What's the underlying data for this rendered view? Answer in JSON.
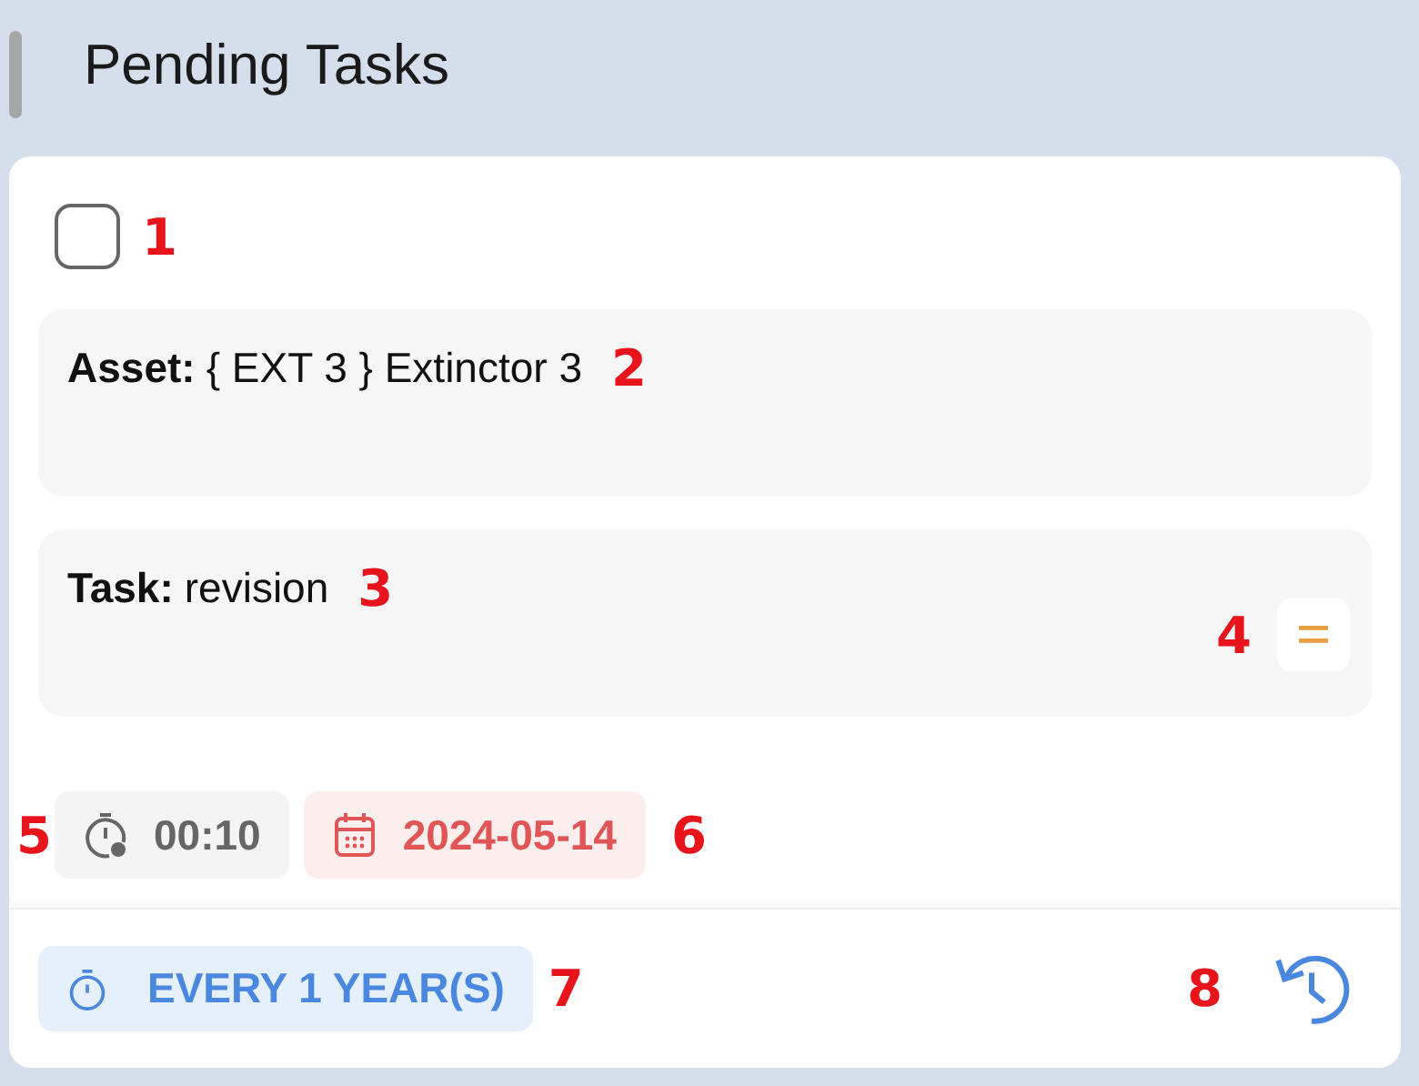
{
  "header": {
    "title": "Pending Tasks"
  },
  "task_card": {
    "checkbox": {
      "checked": false
    },
    "asset": {
      "label": "Asset:",
      "value": "{ EXT 3 } Extinctor 3"
    },
    "task": {
      "label": "Task:",
      "value": "revision"
    },
    "duration": "00:10",
    "due_date": "2024-05-14",
    "recurrence": "EVERY 1 YEAR(S)"
  },
  "callouts": [
    "1",
    "2",
    "3",
    "4",
    "5",
    "6",
    "7",
    "8"
  ]
}
